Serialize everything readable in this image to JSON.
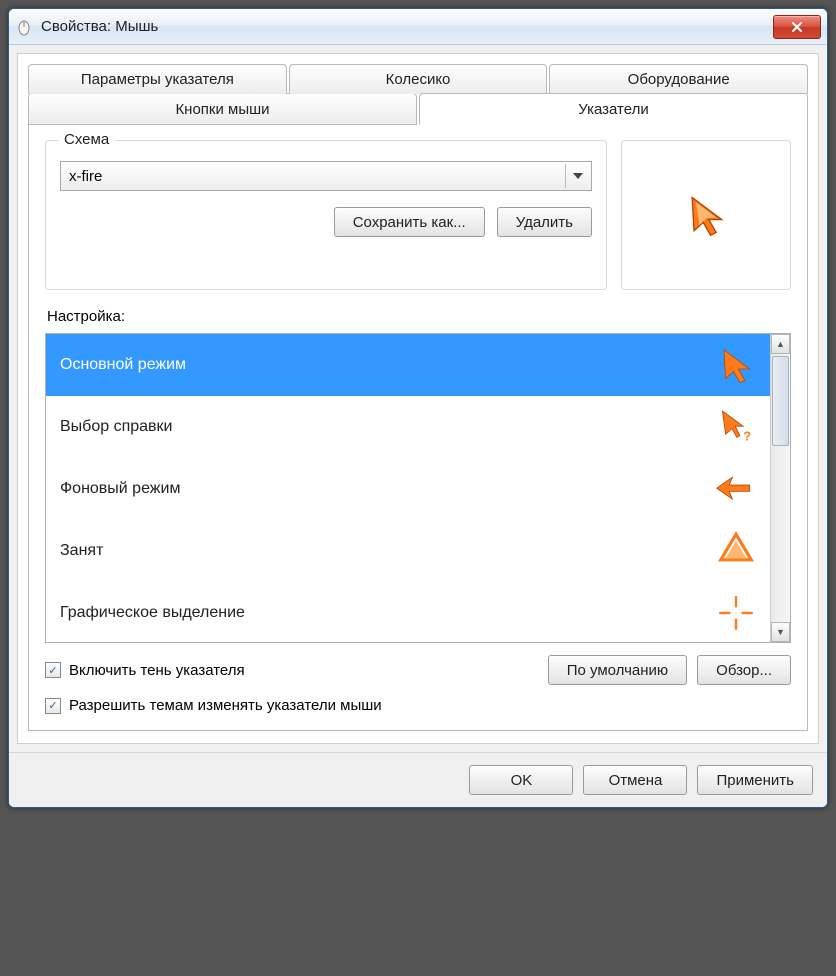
{
  "window": {
    "title": "Свойства: Мышь"
  },
  "tabs_top": [
    {
      "label": "Параметры указателя"
    },
    {
      "label": "Колесико"
    },
    {
      "label": "Оборудование"
    }
  ],
  "tabs_bottom": [
    {
      "label": "Кнопки мыши",
      "active": false
    },
    {
      "label": "Указатели",
      "active": true
    }
  ],
  "scheme": {
    "legend": "Схема",
    "value": "x-fire",
    "save_as": "Сохранить как...",
    "delete": "Удалить"
  },
  "customize_label": "Настройка:",
  "cursors": [
    {
      "label": "Основной режим",
      "icon": "arrow"
    },
    {
      "label": "Выбор справки",
      "icon": "help"
    },
    {
      "label": "Фоновый режим",
      "icon": "working"
    },
    {
      "label": "Занят",
      "icon": "busy"
    },
    {
      "label": "Графическое выделение",
      "icon": "precision"
    }
  ],
  "checks": {
    "shadow": "Включить тень указателя",
    "themes": "Разрешить темам изменять указатели мыши"
  },
  "buttons": {
    "default": "По умолчанию",
    "browse": "Обзор...",
    "ok": "OK",
    "cancel": "Отмена",
    "apply": "Применить"
  }
}
